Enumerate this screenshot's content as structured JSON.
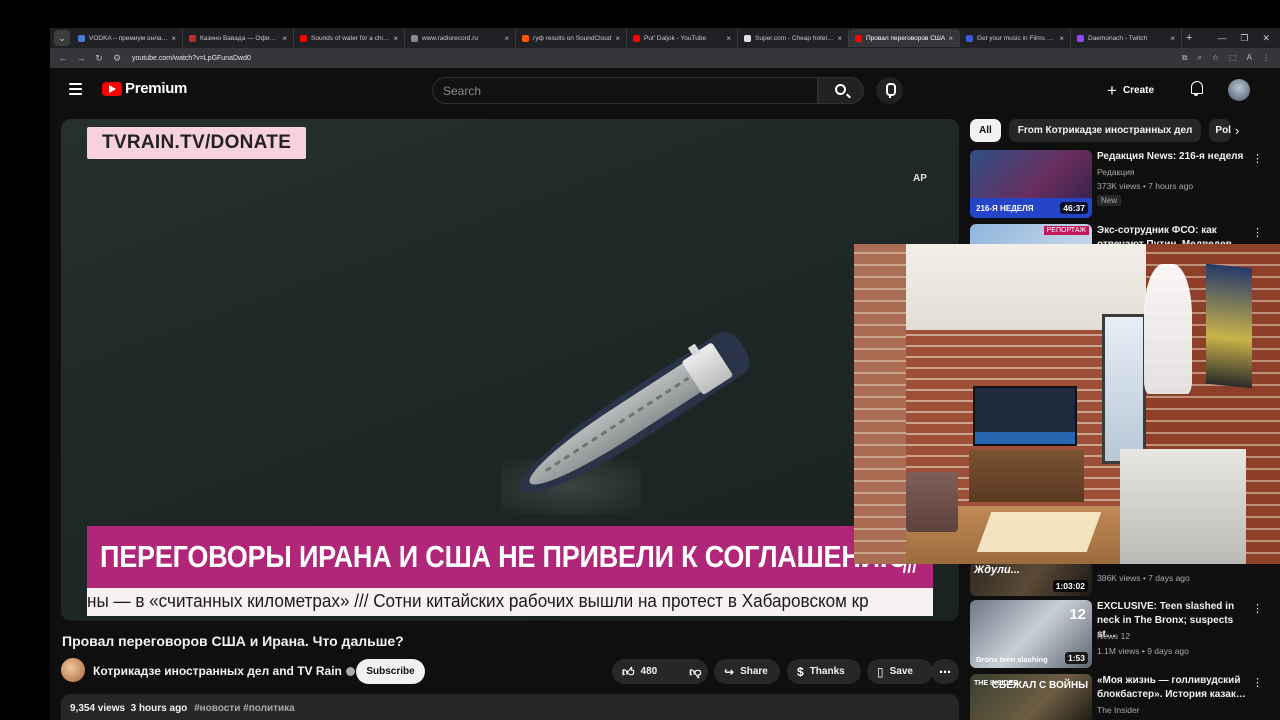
{
  "browser": {
    "tabs": [
      {
        "title": "VODKA – премиум онлайн-к",
        "color": "#4a7bd1"
      },
      {
        "title": "Казино Вавада — Официаль",
        "color": "#c62828"
      },
      {
        "title": "Sounds of water for a child to",
        "color": "#ff0000"
      },
      {
        "title": "www.radiorecord.ru",
        "color": "#888888"
      },
      {
        "title": "гуф results on SoundCloud",
        "color": "#ff5500"
      },
      {
        "title": "Put' Daljok - YouTube",
        "color": "#ff0000"
      },
      {
        "title": "Super.com - Cheap hotel deal",
        "color": "#e0e0e0"
      },
      {
        "title": "Провал переговоров США",
        "color": "#ff0000",
        "active": true
      },
      {
        "title": "Get your music in Films & TV",
        "color": "#3a5bd9"
      },
      {
        "title": "Daemonach - Twitch",
        "color": "#9146ff"
      }
    ],
    "url": "youtube.com/watch?v=LpGFunaDwd0"
  },
  "header": {
    "brand": "Premium",
    "search_placeholder": "Search",
    "create_label": "Create"
  },
  "player": {
    "donate_banner": "TVRAIN.TV/DONATE",
    "ap_label": "AP",
    "headline": "ПЕРЕГОВОРЫ ИРАНА И США НЕ ПРИВЕЛИ К СОГЛАШЕНИЮ",
    "headline_slashes": "///",
    "ticker": "ны — в «считанных километрах» /// Сотни китайских рабочих вышли на протест в Хабаровском кр"
  },
  "video": {
    "title": "Провал переговоров США и Ирана. Что дальше?",
    "channel": "Котрикадзе иностранных дел and TV Rain",
    "subscribe_label": "Subscribe",
    "likes": "480",
    "share_label": "Share",
    "thanks_label": "Thanks",
    "save_label": "Save",
    "views": "9,354 views",
    "age": "3 hours ago",
    "tags": "#новости #политика"
  },
  "sidebar": {
    "chips": [
      "All",
      "From Котрикадзе иностранных дел",
      "Pol"
    ],
    "recs": [
      {
        "title": "Редакция News: 216-я неделя",
        "channel": "Редакция",
        "stats": "373K views • 7 hours ago",
        "badge": "New",
        "duration": "46:37",
        "thumb_label": "216-Я НЕДЕЛЯ"
      },
      {
        "title": "Экс-сотрудник ФСО: как отвечают Путин, Медведев",
        "channel": "",
        "stats": "",
        "badge": "",
        "duration": "",
        "thumb_label": "РЕПОРТАЖ"
      },
      {
        "title": "",
        "channel": "",
        "stats": "386K views • 7 days ago",
        "badge": "",
        "duration": "1:03:02",
        "thumb_label": "Ждули..."
      },
      {
        "title": "EXCLUSIVE: Teen slashed in neck in The Bronx; suspects st…",
        "channel": "News 12",
        "stats": "1.1M views • 9 days ago",
        "badge": "",
        "duration": "1:53",
        "thumb_label": "Bronx teen slashing",
        "thumb_num": "12"
      },
      {
        "title": "«Моя жизнь — голливудский блокбастер». История казак…",
        "channel": "The Insider",
        "stats": "",
        "badge": "",
        "duration": "",
        "thumb_label": "THE INSIDER",
        "thumb_big": "СБЕЖАЛ С ВОЙНЫ"
      }
    ]
  }
}
